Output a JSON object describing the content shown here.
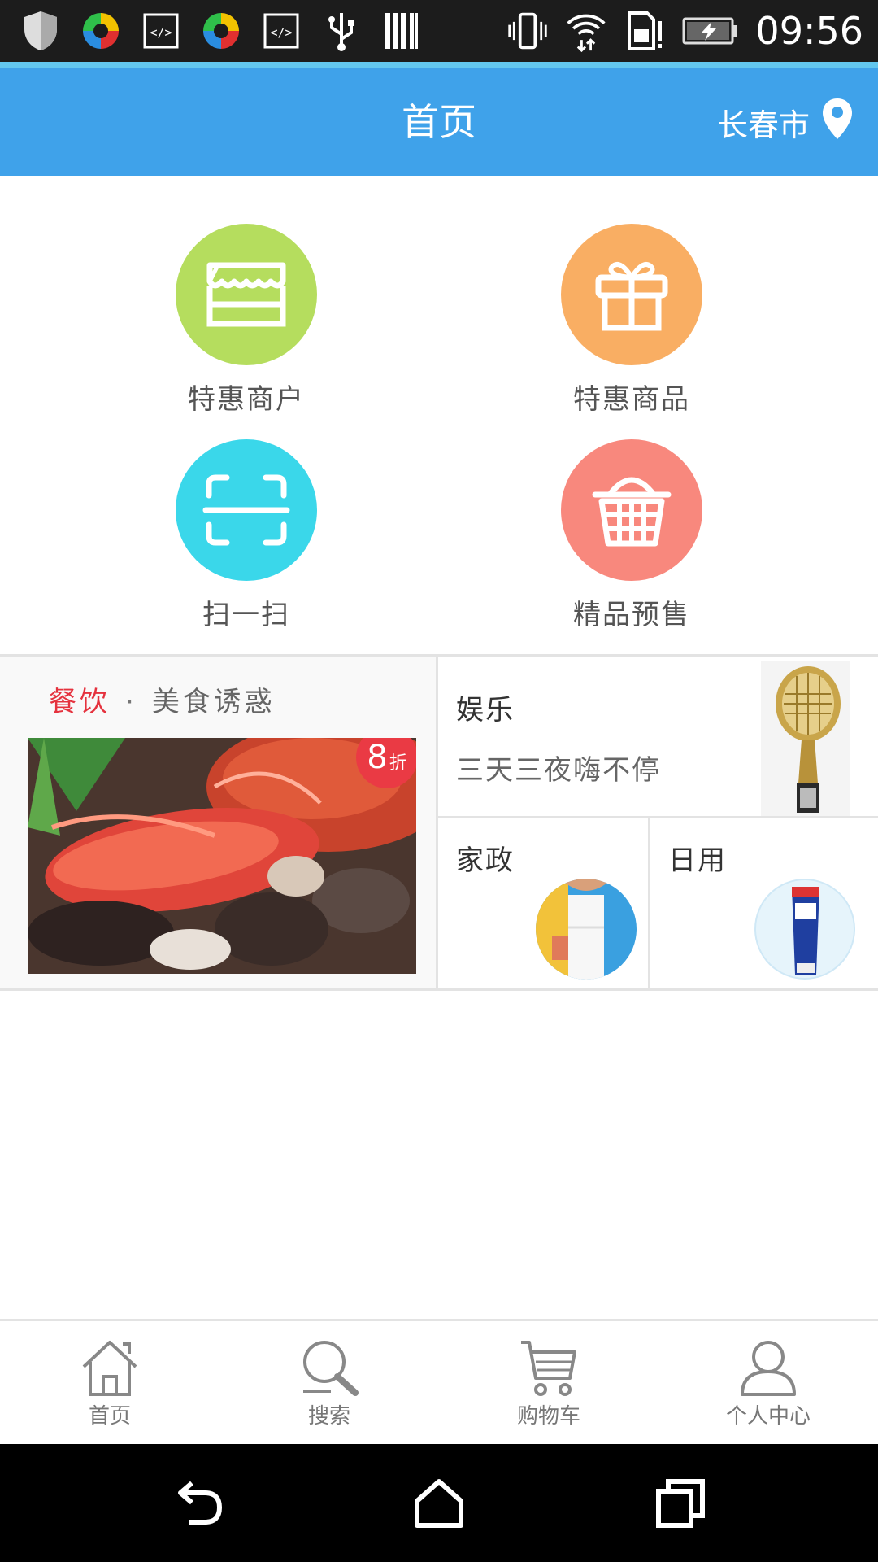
{
  "status_bar": {
    "time": "09:56",
    "icons": [
      "shield-icon",
      "app-icon",
      "code-icon",
      "app-icon",
      "code-icon",
      "usb-icon",
      "barcode-icon",
      "vibrate-icon",
      "wifi-icon",
      "sim-alert-icon",
      "battery-charging-icon"
    ]
  },
  "header": {
    "title": "首页",
    "city": "长春市"
  },
  "quick_actions": [
    {
      "label": "特惠商户",
      "icon": "store-icon",
      "color": "#b5dd5e"
    },
    {
      "label": "特惠商品",
      "icon": "gift-icon",
      "color": "#f9ae63"
    },
    {
      "label": "扫一扫",
      "icon": "scan-icon",
      "color": "#3ad7ea"
    },
    {
      "label": "精品预售",
      "icon": "basket-icon",
      "color": "#f8887d"
    }
  ],
  "categories": {
    "food": {
      "name": "餐饮",
      "dot": "·",
      "slogan": "美食诱惑",
      "badge_number": "8",
      "badge_unit": "折"
    },
    "entertainment": {
      "name": "娱乐",
      "slogan": "三天三夜嗨不停"
    },
    "housekeeping": {
      "name": "家政"
    },
    "daily": {
      "name": "日用"
    }
  },
  "bottom_nav": [
    {
      "label": "首页",
      "icon": "home-icon"
    },
    {
      "label": "搜索",
      "icon": "search-icon"
    },
    {
      "label": "购物车",
      "icon": "cart-icon"
    },
    {
      "label": "个人中心",
      "icon": "user-icon"
    }
  ],
  "colors": {
    "accent": "#3fa2ea",
    "food_red": "#e5323e"
  }
}
